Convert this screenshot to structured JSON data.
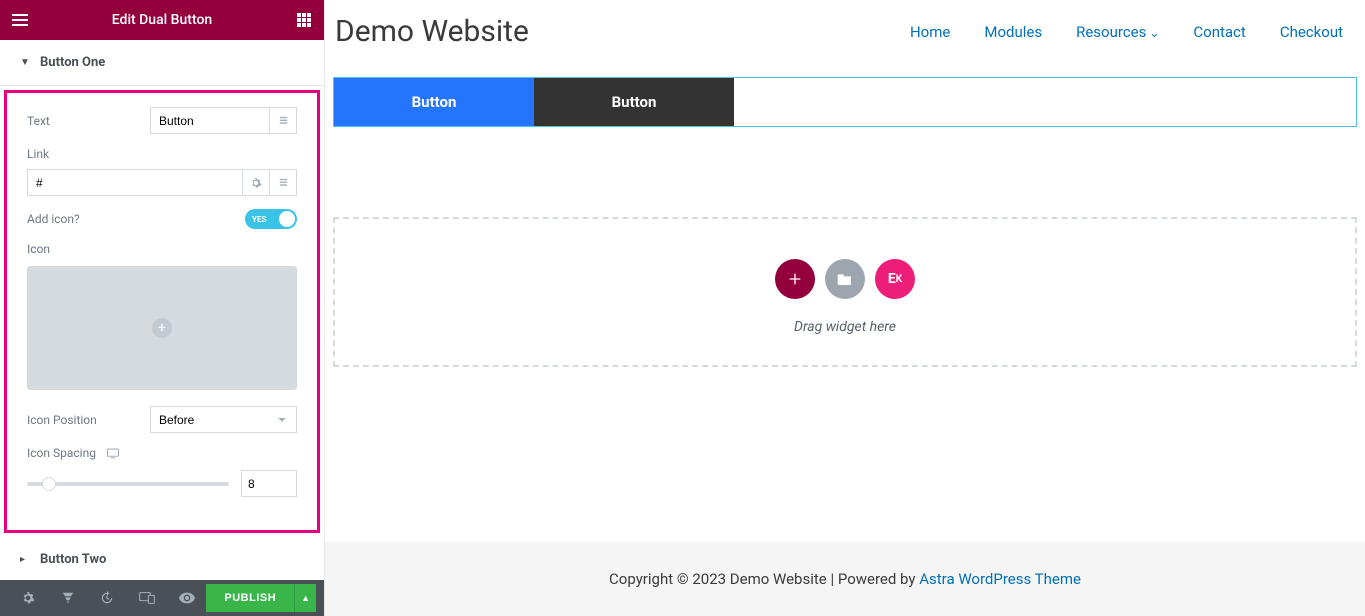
{
  "sidebar": {
    "title": "Edit Dual Button",
    "sections": {
      "button_one": {
        "label": "Button One"
      },
      "button_two": {
        "label": "Button Two"
      }
    },
    "fields": {
      "text_label": "Text",
      "text_value": "Button",
      "link_label": "Link",
      "link_value": "#",
      "add_icon_label": "Add icon?",
      "add_icon_value": "YES",
      "icon_label": "Icon",
      "icon_position_label": "Icon Position",
      "icon_position_value": "Before",
      "icon_spacing_label": "Icon Spacing",
      "icon_spacing_value": "8"
    },
    "footer": {
      "publish": "PUBLISH"
    }
  },
  "site": {
    "title": "Demo Website",
    "nav": {
      "home": "Home",
      "modules": "Modules",
      "resources": "Resources",
      "contact": "Contact",
      "checkout": "Checkout"
    },
    "buttons": {
      "b1": "Button",
      "b2": "Button"
    },
    "dropzone": "Drag widget here",
    "footer_text": "Copyright © 2023 Demo Website | Powered by ",
    "footer_link": "Astra WordPress Theme"
  }
}
